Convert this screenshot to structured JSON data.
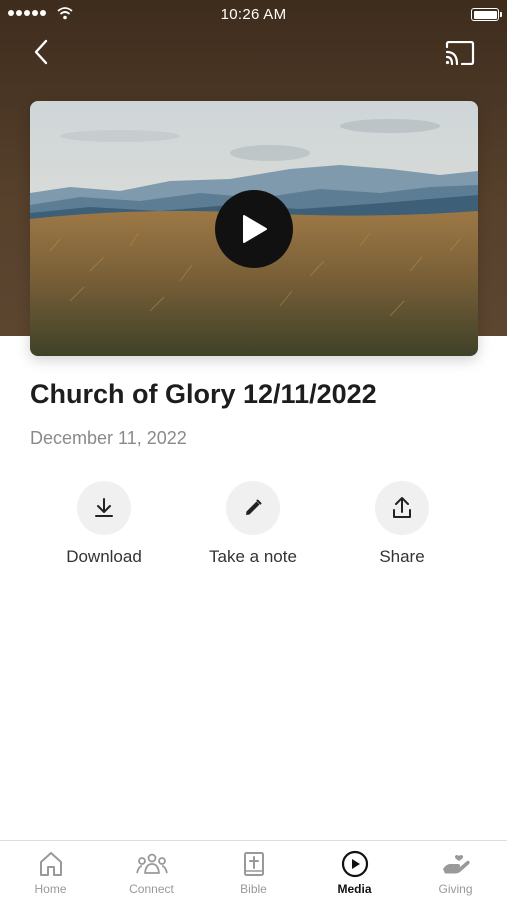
{
  "status_bar": {
    "time": "10:26 AM"
  },
  "video": {
    "title": "Church of Glory 12/11/2022",
    "date": "December 11, 2022"
  },
  "actions": [
    {
      "label": "Download",
      "icon": "download-icon"
    },
    {
      "label": "Take a note",
      "icon": "pencil-icon"
    },
    {
      "label": "Share",
      "icon": "share-icon"
    }
  ],
  "tabs": [
    {
      "label": "Home",
      "icon": "home-icon",
      "active": false
    },
    {
      "label": "Connect",
      "icon": "people-icon",
      "active": false
    },
    {
      "label": "Bible",
      "icon": "bible-icon",
      "active": false
    },
    {
      "label": "Media",
      "icon": "play-circle-icon",
      "active": true
    },
    {
      "label": "Giving",
      "icon": "giving-hand-icon",
      "active": false
    }
  ],
  "colors": {
    "header_brown": "#57412c",
    "active_tab": "#111111",
    "inactive_tab": "#999999"
  }
}
